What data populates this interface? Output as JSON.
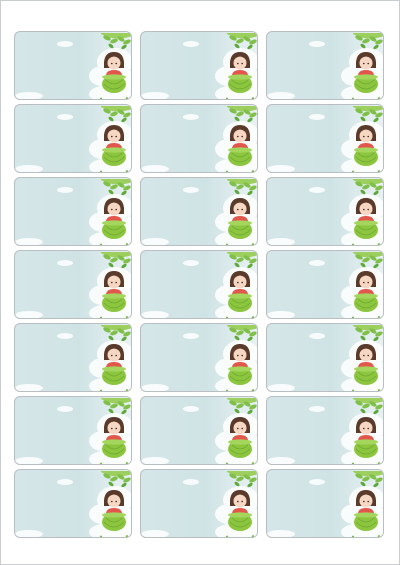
{
  "sheet": {
    "label_count": 21,
    "columns": 3,
    "rows": 7,
    "label_text": ""
  },
  "colors": {
    "page": "#ffffff",
    "label_background": "#d5e6e8",
    "label_border": "#b9bec3",
    "leaves": "#7fbf4a",
    "cloud": "#ffffff",
    "hair": "#5a3a2a",
    "shirt": "#e2574c",
    "pot": "#8cc63f"
  },
  "icons": [
    "leaves-icon",
    "cloud-icon",
    "girl-in-pot-icon"
  ]
}
